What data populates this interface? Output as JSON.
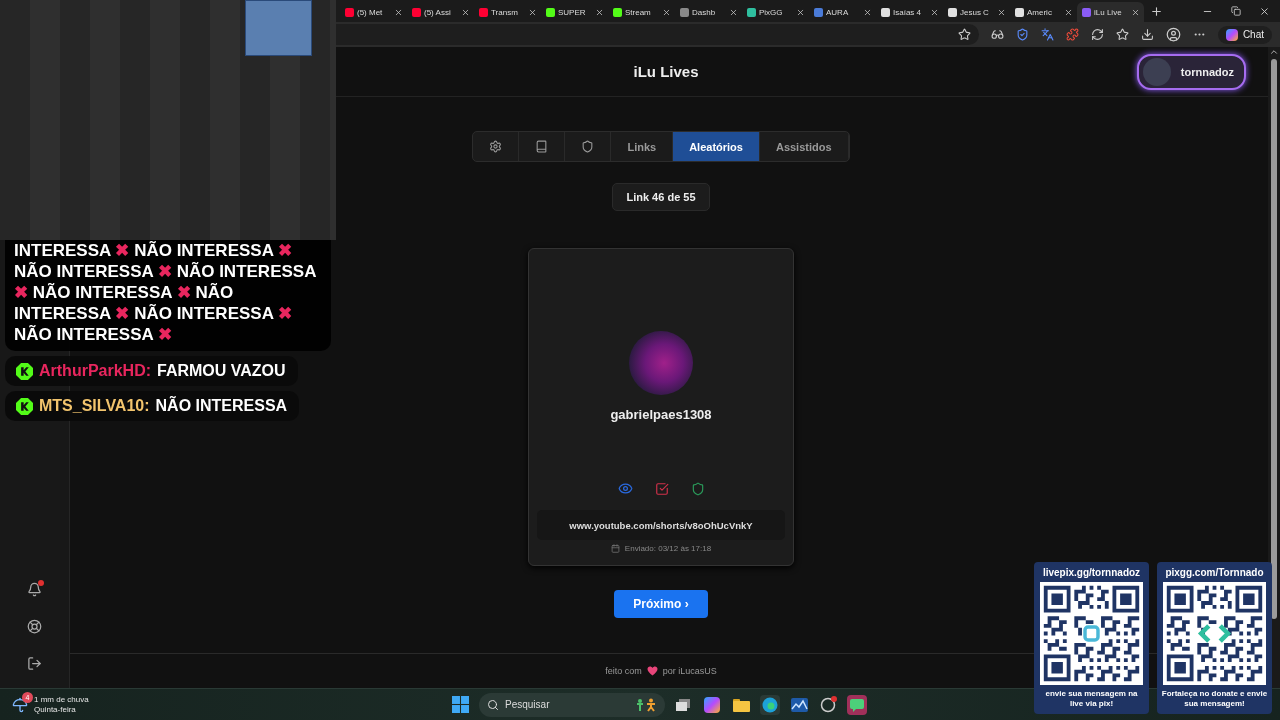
{
  "browser": {
    "tabs": [
      {
        "title": "(5) Met",
        "color": "#ff0033",
        "selected": false
      },
      {
        "title": "(5) Assi",
        "color": "#ff0033",
        "selected": false
      },
      {
        "title": "Transm",
        "color": "#ff0033",
        "selected": false
      },
      {
        "title": "SUPER",
        "color": "#53fc18",
        "selected": false
      },
      {
        "title": "Stream",
        "color": "#53fc18",
        "selected": false
      },
      {
        "title": "Dashb",
        "color": "#8a8a8a",
        "selected": false
      },
      {
        "title": "PixGG",
        "color": "#2fbf9f",
        "selected": false
      },
      {
        "title": "AURA",
        "color": "#4a7bd8",
        "selected": false
      },
      {
        "title": "Isaías 4",
        "color": "#e0e0e0",
        "selected": false
      },
      {
        "title": "Jesus C",
        "color": "#e0e0e0",
        "selected": false
      },
      {
        "title": "Americ",
        "color": "#e0e0e0",
        "selected": false
      },
      {
        "title": "iLu Live",
        "color": "#8b5cf6",
        "selected": true
      }
    ],
    "chat_button": "Chat"
  },
  "site": {
    "title": "iLu Lives",
    "user": "tornnadoz"
  },
  "nav_tabs": [
    {
      "kind": "icon",
      "selected": false
    },
    {
      "kind": "icon",
      "selected": false
    },
    {
      "kind": "icon",
      "selected": false
    },
    {
      "kind": "text",
      "label": "Links",
      "selected": false
    },
    {
      "kind": "text",
      "label": "Aleatórios",
      "selected": true
    },
    {
      "kind": "text",
      "label": "Assistidos",
      "selected": false
    }
  ],
  "counter": "Link 46 de 55",
  "card": {
    "username": "gabrielpaes1308",
    "url": "www.youtube.com/shorts/v8oOhUcVnkY",
    "sent": "Enviado: 03/12 às 17:18"
  },
  "next_button": "Próximo ›",
  "footer": {
    "before": "feito com",
    "after": "por iLucasUS"
  },
  "chat": {
    "messages": [
      {
        "kind": "plain",
        "parts": [
          {
            "kind": "text",
            "text": "INTERESSA"
          },
          {
            "kind": "mark",
            "text": "✖"
          },
          {
            "kind": "text",
            "text": "NÃO INTERESSA"
          },
          {
            "kind": "mark",
            "text": "✖"
          },
          {
            "kind": "text",
            "text": "NÃO INTERESSA"
          },
          {
            "kind": "mark",
            "text": "✖"
          },
          {
            "kind": "text",
            "text": "NÃO INTERESSA"
          },
          {
            "kind": "mark",
            "text": "✖"
          },
          {
            "kind": "text",
            "text": "NÃO INTERESSA"
          },
          {
            "kind": "mark",
            "text": "✖"
          },
          {
            "kind": "text",
            "text": "NÃO INTERESSA"
          },
          {
            "kind": "mark",
            "text": "✖"
          },
          {
            "kind": "text",
            "text": "NÃO INTERESSA"
          },
          {
            "kind": "mark",
            "text": "✖"
          },
          {
            "kind": "text",
            "text": "NÃO INTERESSA"
          },
          {
            "kind": "mark",
            "text": "✖"
          }
        ]
      },
      {
        "kind": "user",
        "username": "ArthurParkHD:",
        "color": "#e8265e",
        "text": "FARMOU VAZOU"
      },
      {
        "kind": "user",
        "username": "MTS_SILVA10:",
        "color": "#f2c46d",
        "text": "NÃO INTERESSA"
      }
    ]
  },
  "donation_cards": [
    {
      "title": "livepix.gg/tornnadoz",
      "caption": "envie sua mensagem na live via pix!"
    },
    {
      "title": "pixgg.com/Tornnado",
      "caption": "Fortaleça no donate e envie sua mensagem!"
    }
  ],
  "taskbar": {
    "weather": {
      "badge": "4",
      "line1": "1 mm de chuva",
      "line2": "Quinta-feira"
    },
    "search": {
      "placeholder": "Pesquisar"
    }
  }
}
